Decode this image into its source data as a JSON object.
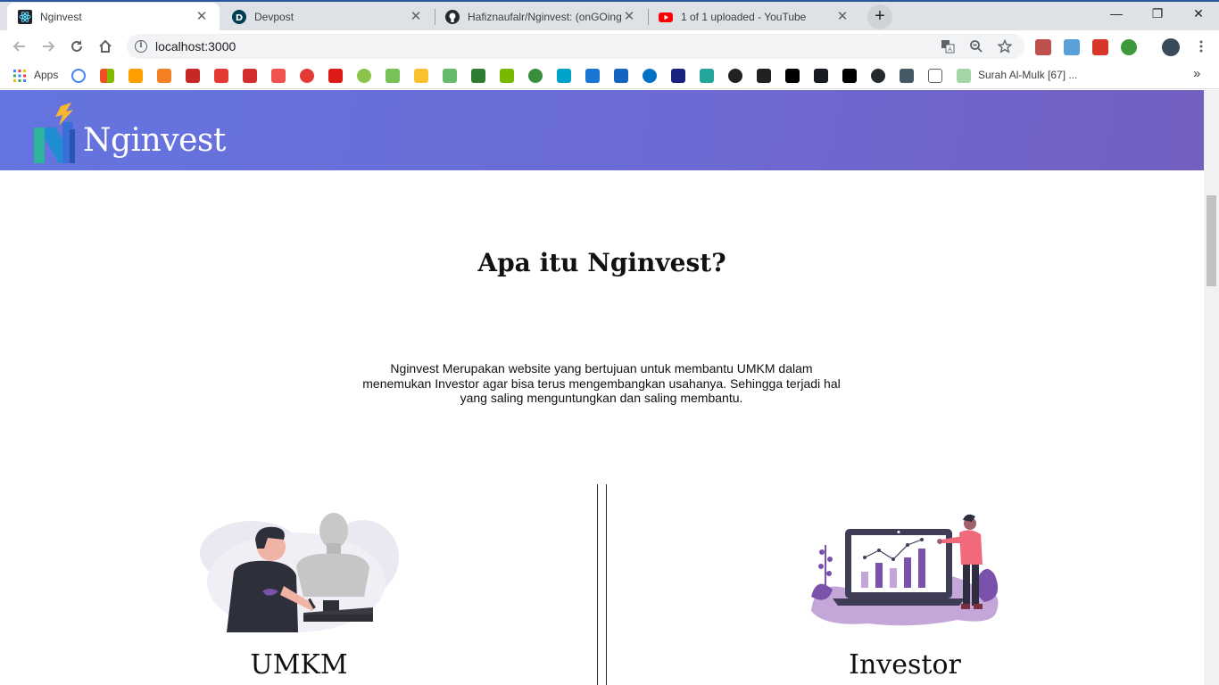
{
  "browser": {
    "tabs": [
      {
        "title": "Nginvest",
        "active": true,
        "favicon": "react-icon"
      },
      {
        "title": "Devpost",
        "active": false,
        "favicon": "devpost-icon"
      },
      {
        "title": "Hafiznaufalr/Nginvest: (onGOing",
        "active": false,
        "favicon": "github-icon"
      },
      {
        "title": "1 of 1 uploaded - YouTube",
        "active": false,
        "favicon": "youtube-icon"
      }
    ],
    "new_tab_label": "+",
    "window_controls": {
      "minimize": "—",
      "restore": "❐",
      "close": "✕"
    },
    "address": {
      "url": "localhost:3000"
    },
    "bookmarks": {
      "apps_label": "Apps",
      "last_label": "Surah Al-Mulk [67] ...",
      "overflow": "»"
    }
  },
  "page": {
    "brand": "Nginvest",
    "about": {
      "title": "Apa itu Nginvest?",
      "description": "Nginvest Merupakan website yang bertujuan untuk membantu UMKM dalam menemukan Investor agar bisa terus mengembangkan usahanya. Sehingga terjadi hal yang saling menguntungkan dan saling membantu."
    },
    "sections": [
      {
        "label": "UMKM",
        "illustration": "artist-sculpting-illustration"
      },
      {
        "label": "Investor",
        "illustration": "investor-chart-illustration"
      }
    ]
  },
  "colors": {
    "hero_start": "#6474e0",
    "hero_end": "#735fc0",
    "accent_purple": "#7b52ab",
    "divider": "#1d2a39"
  }
}
